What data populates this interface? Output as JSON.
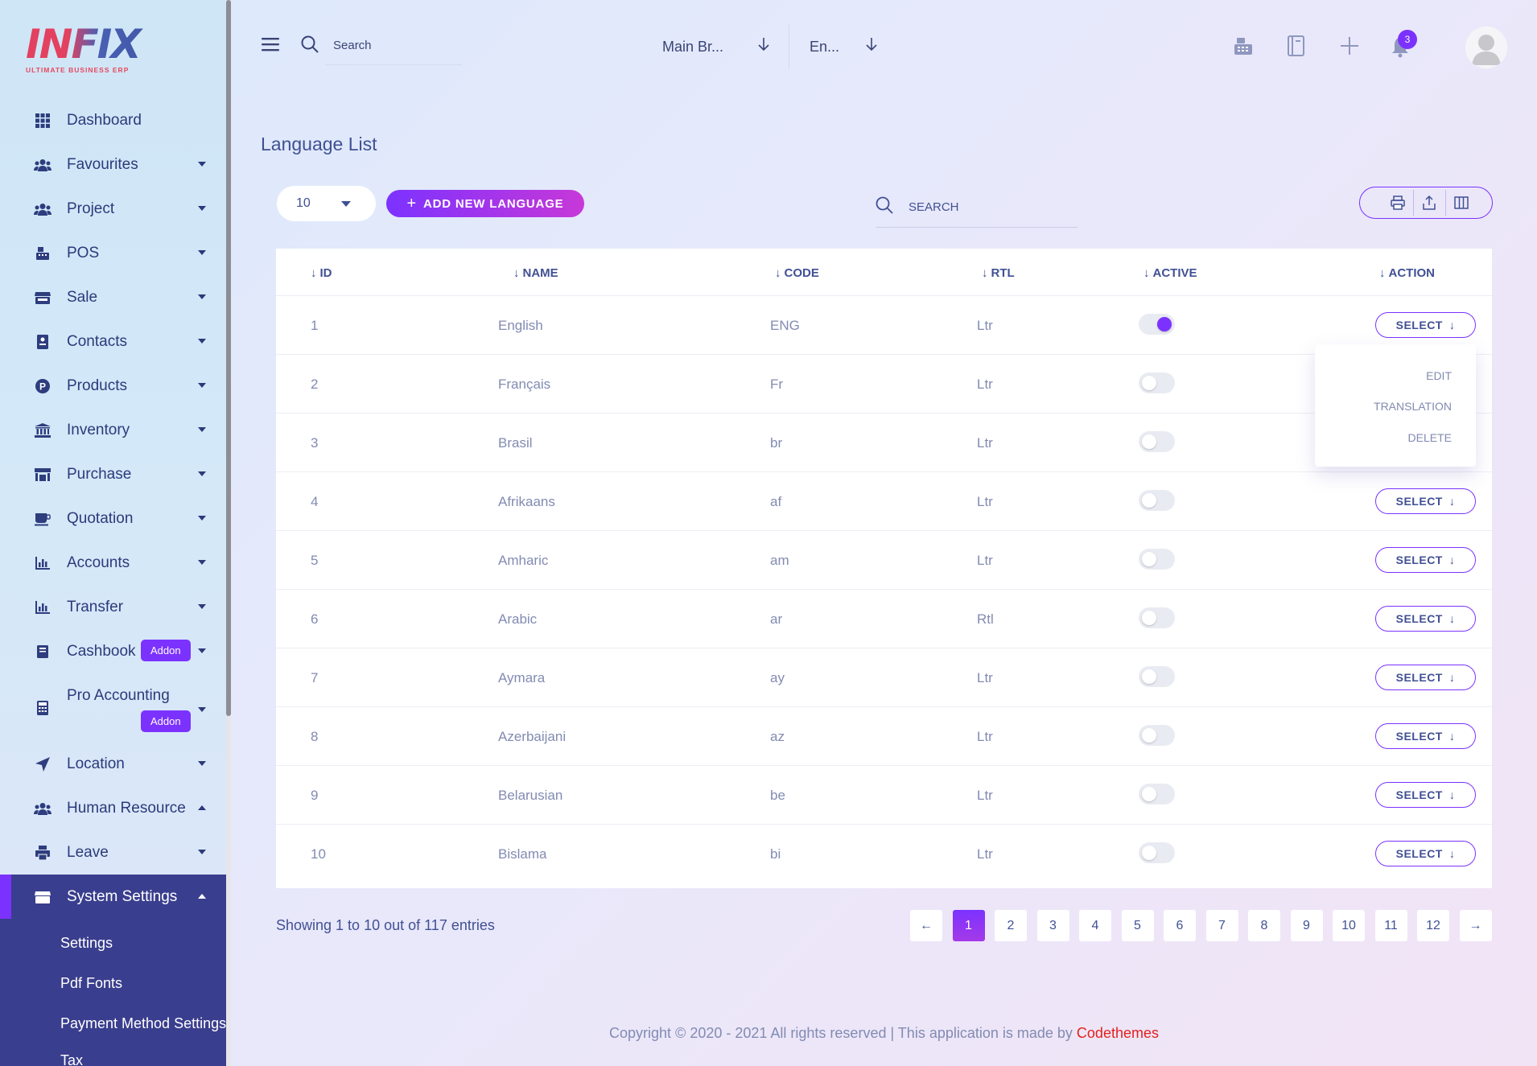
{
  "brand": {
    "logo_text": "INFIX",
    "tagline": "ULTIMATE BUSINESS ERP"
  },
  "sidebar": {
    "items": [
      {
        "label": "Dashboard",
        "icon": "grid-icon"
      },
      {
        "label": "Favourites",
        "icon": "users-icon"
      },
      {
        "label": "Project",
        "icon": "users-icon"
      },
      {
        "label": "POS",
        "icon": "cash-register-icon"
      },
      {
        "label": "Sale",
        "icon": "store-icon"
      },
      {
        "label": "Contacts",
        "icon": "contacts-icon"
      },
      {
        "label": "Products",
        "icon": "product-p-icon"
      },
      {
        "label": "Inventory",
        "icon": "bank-icon"
      },
      {
        "label": "Purchase",
        "icon": "shop-icon"
      },
      {
        "label": "Quotation",
        "icon": "coffee-icon"
      },
      {
        "label": "Accounts",
        "icon": "chart-icon"
      },
      {
        "label": "Transfer",
        "icon": "chart-icon"
      },
      {
        "label": "Cashbook",
        "icon": "book-icon",
        "badge": "Addon"
      },
      {
        "label": "Pro Accounting",
        "icon": "calculator-icon",
        "badge": "Addon"
      },
      {
        "label": "Location",
        "icon": "location-arrow-icon"
      },
      {
        "label": "Human Resource",
        "icon": "users-icon"
      },
      {
        "label": "Leave",
        "icon": "print-icon"
      },
      {
        "label": "System Settings",
        "icon": "store-icon"
      }
    ],
    "submenu": [
      "Settings",
      "Pdf Fonts",
      "Payment Method Settings",
      "Tax"
    ]
  },
  "header": {
    "search_placeholder": "Search",
    "branch": "Main Br...",
    "language": "En...",
    "notification_count": "3"
  },
  "page": {
    "title": "Language List",
    "page_size": "10",
    "add_button": "ADD NEW LANGUAGE",
    "search_label": "SEARCH"
  },
  "table": {
    "columns": [
      "ID",
      "NAME",
      "CODE",
      "RTL",
      "ACTIVE",
      "ACTION"
    ],
    "rows": [
      {
        "id": "1",
        "name": "English",
        "code": "ENG",
        "rtl": "Ltr",
        "active": true
      },
      {
        "id": "2",
        "name": "Français",
        "code": "Fr",
        "rtl": "Ltr",
        "active": false
      },
      {
        "id": "3",
        "name": "Brasil",
        "code": "br",
        "rtl": "Ltr",
        "active": false
      },
      {
        "id": "4",
        "name": "Afrikaans",
        "code": "af",
        "rtl": "Ltr",
        "active": false
      },
      {
        "id": "5",
        "name": "Amharic",
        "code": "am",
        "rtl": "Ltr",
        "active": false
      },
      {
        "id": "6",
        "name": "Arabic",
        "code": "ar",
        "rtl": "Rtl",
        "active": false
      },
      {
        "id": "7",
        "name": "Aymara",
        "code": "ay",
        "rtl": "Ltr",
        "active": false
      },
      {
        "id": "8",
        "name": "Azerbaijani",
        "code": "az",
        "rtl": "Ltr",
        "active": false
      },
      {
        "id": "9",
        "name": "Belarusian",
        "code": "be",
        "rtl": "Ltr",
        "active": false
      },
      {
        "id": "10",
        "name": "Bislama",
        "code": "bi",
        "rtl": "Ltr",
        "active": false
      }
    ],
    "select_label": "SELECT",
    "dropdown": [
      "EDIT",
      "TRANSLATION",
      "DELETE"
    ]
  },
  "pagination": {
    "summary": "Showing 1 to 10 out of 117 entries",
    "prev": "←",
    "next": "→",
    "pages": [
      "1",
      "2",
      "3",
      "4",
      "5",
      "6",
      "7",
      "8",
      "9",
      "10",
      "11",
      "12"
    ],
    "current": "1"
  },
  "footer": {
    "text": "Copyright © 2020 - 2021 All rights reserved | This application is made by ",
    "brand": "Codethemes"
  },
  "colors": {
    "accent": "#7c32ff",
    "text": "#415094",
    "muted": "#828bb2",
    "sidebar_active": "#3a3e8e",
    "footer_brand": "#e3211d"
  }
}
